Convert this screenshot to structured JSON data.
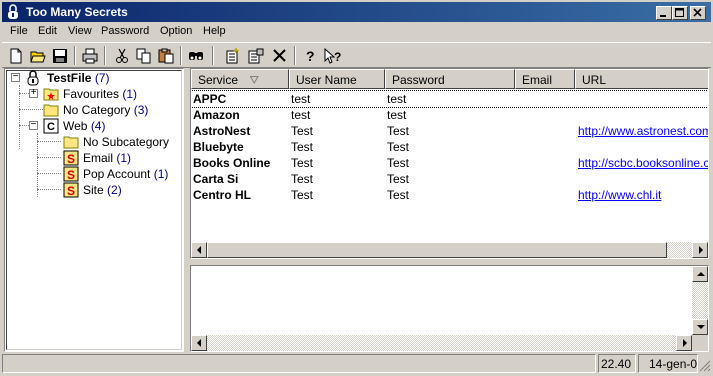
{
  "window": {
    "title": "Too Many Secrets",
    "icon": "padlock-icon"
  },
  "menu": [
    "File",
    "Edit",
    "View",
    "Password",
    "Option",
    "Help"
  ],
  "toolbar": {
    "buttons": [
      "new-icon",
      "open-icon",
      "save-icon",
      "print-icon",
      "cut-icon",
      "copy-icon",
      "paste-icon",
      "find-icon",
      "new-entry-icon",
      "properties-icon",
      "delete-icon",
      "help-icon",
      "context-help-icon"
    ]
  },
  "tree": {
    "root": {
      "label": "TestFile",
      "count": "(7)"
    },
    "nodes": [
      {
        "label": "Favourites",
        "count": "(1)"
      },
      {
        "label": "No Category",
        "count": "(3)"
      },
      {
        "label": "Web",
        "count": "(4)"
      },
      {
        "label": "No Subcategory",
        "count": ""
      },
      {
        "label": "Email",
        "count": "(1)"
      },
      {
        "label": "Pop Account",
        "count": "(1)"
      },
      {
        "label": "Site",
        "count": "(2)"
      }
    ]
  },
  "list": {
    "columns": [
      "Service",
      "User Name",
      "Password",
      "Email",
      "URL"
    ],
    "rows": [
      {
        "service": "APPC",
        "user": "test",
        "password": "test",
        "email": "",
        "url": ""
      },
      {
        "service": "Amazon",
        "user": "test",
        "password": "test",
        "email": "",
        "url": ""
      },
      {
        "service": "AstroNest",
        "user": "Test",
        "password": "Test",
        "email": "",
        "url": "http://www.astronest.com"
      },
      {
        "service": "Bluebyte",
        "user": "Test",
        "password": "Test",
        "email": "",
        "url": ""
      },
      {
        "service": "Books Online",
        "user": "Test",
        "password": "Test",
        "email": "",
        "url": "http://scbc.booksonline.co"
      },
      {
        "service": "Carta Si",
        "user": "Test",
        "password": "Test",
        "email": "",
        "url": ""
      },
      {
        "service": "Centro HL",
        "user": "Test",
        "password": "Test",
        "email": "",
        "url": "http://www.chl.it"
      }
    ]
  },
  "status": {
    "main": "",
    "time": "22.40",
    "date": "14-gen-02"
  },
  "colors": {
    "title_bar": "#0a246a",
    "link": "#0000ff",
    "count": "#00008b",
    "face": "#d4d0c8"
  }
}
